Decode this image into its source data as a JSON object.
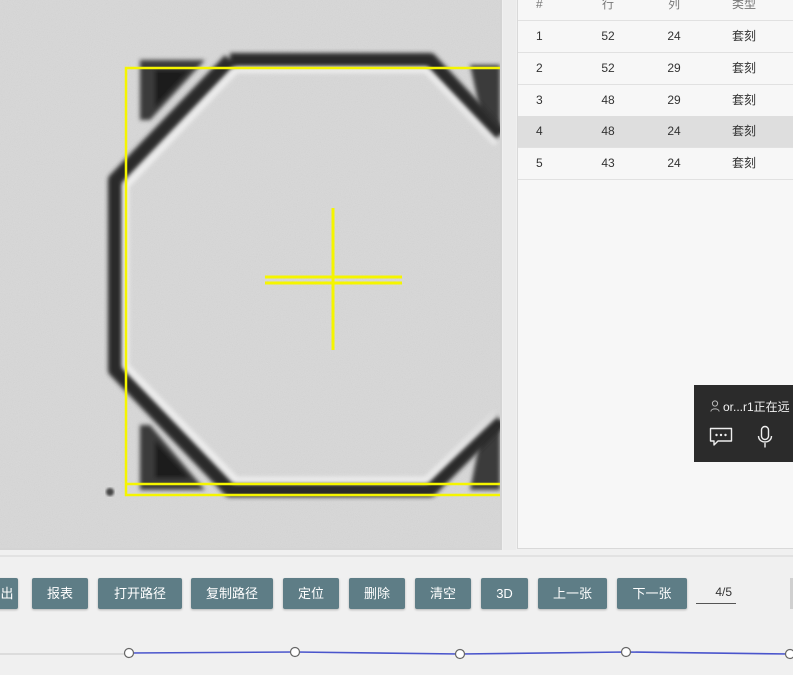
{
  "table": {
    "headers": {
      "index": "#",
      "row": "行",
      "col": "列",
      "type": "类型"
    },
    "rows": [
      {
        "index": "1",
        "row": "52",
        "col": "24",
        "type": "套刻",
        "selected": false
      },
      {
        "index": "2",
        "row": "52",
        "col": "29",
        "type": "套刻",
        "selected": false
      },
      {
        "index": "3",
        "row": "48",
        "col": "29",
        "type": "套刻",
        "selected": false
      },
      {
        "index": "4",
        "row": "48",
        "col": "24",
        "type": "套刻",
        "selected": true
      },
      {
        "index": "5",
        "row": "43",
        "col": "24",
        "type": "套刻",
        "selected": false
      }
    ]
  },
  "toolbar": {
    "export_partial": "出",
    "report": "报表",
    "open_path": "打开路径",
    "copy_path": "复制路径",
    "locate": "定位",
    "delete": "删除",
    "clear": "清空",
    "view_3d": "3D",
    "prev": "上一张",
    "next": "下一张",
    "page": "4/5"
  },
  "toast": {
    "message": "or...r1正在远",
    "icons": [
      "user-icon",
      "chat-icon",
      "microphone-icon"
    ]
  },
  "colors": {
    "button_bg": "#5e7d86",
    "overlay_yellow": "#f5f500",
    "timeline_line": "#4a55cc"
  }
}
